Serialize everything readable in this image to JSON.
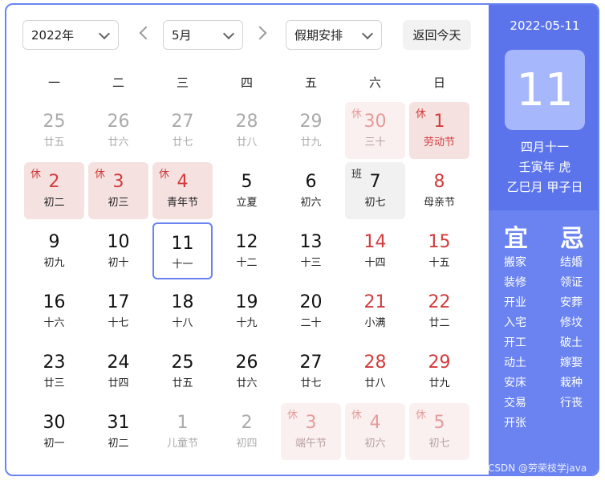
{
  "toolbar": {
    "year": "2022年",
    "month": "5月",
    "holiday": "假期安排",
    "today_button": "返回今天"
  },
  "weekdays": [
    "一",
    "二",
    "三",
    "四",
    "五",
    "六",
    "日"
  ],
  "days": [
    {
      "n": "25",
      "s": "廿五",
      "st": "other"
    },
    {
      "n": "26",
      "s": "廿六",
      "st": "other"
    },
    {
      "n": "27",
      "s": "廿七",
      "st": "other"
    },
    {
      "n": "28",
      "s": "廿八",
      "st": "other"
    },
    {
      "n": "29",
      "s": "廿九",
      "st": "other"
    },
    {
      "n": "30",
      "s": "三十",
      "st": "other rest",
      "t": "休"
    },
    {
      "n": "1",
      "s": "劳动节",
      "st": "rest",
      "t": "休"
    },
    {
      "n": "2",
      "s": "初二",
      "st": "rest plainsub",
      "t": "休"
    },
    {
      "n": "3",
      "s": "初三",
      "st": "rest plainsub",
      "t": "休"
    },
    {
      "n": "4",
      "s": "青年节",
      "st": "rest plainsub",
      "t": "休"
    },
    {
      "n": "5",
      "s": "立夏",
      "st": ""
    },
    {
      "n": "6",
      "s": "初六",
      "st": ""
    },
    {
      "n": "7",
      "s": "初七",
      "st": "work",
      "t": "班"
    },
    {
      "n": "8",
      "s": "母亲节",
      "st": "weekend"
    },
    {
      "n": "9",
      "s": "初九",
      "st": ""
    },
    {
      "n": "10",
      "s": "初十",
      "st": ""
    },
    {
      "n": "11",
      "s": "十一",
      "st": "selected"
    },
    {
      "n": "12",
      "s": "十二",
      "st": ""
    },
    {
      "n": "13",
      "s": "十三",
      "st": ""
    },
    {
      "n": "14",
      "s": "十四",
      "st": "weekend"
    },
    {
      "n": "15",
      "s": "十五",
      "st": "weekend"
    },
    {
      "n": "16",
      "s": "十六",
      "st": ""
    },
    {
      "n": "17",
      "s": "十七",
      "st": ""
    },
    {
      "n": "18",
      "s": "十八",
      "st": ""
    },
    {
      "n": "19",
      "s": "十九",
      "st": ""
    },
    {
      "n": "20",
      "s": "二十",
      "st": ""
    },
    {
      "n": "21",
      "s": "小满",
      "st": "weekend"
    },
    {
      "n": "22",
      "s": "廿二",
      "st": "weekend"
    },
    {
      "n": "23",
      "s": "廿三",
      "st": ""
    },
    {
      "n": "24",
      "s": "廿四",
      "st": ""
    },
    {
      "n": "25",
      "s": "廿五",
      "st": ""
    },
    {
      "n": "26",
      "s": "廿六",
      "st": ""
    },
    {
      "n": "27",
      "s": "廿七",
      "st": ""
    },
    {
      "n": "28",
      "s": "廿八",
      "st": "weekend"
    },
    {
      "n": "29",
      "s": "廿九",
      "st": "weekend"
    },
    {
      "n": "30",
      "s": "初一",
      "st": ""
    },
    {
      "n": "31",
      "s": "初二",
      "st": ""
    },
    {
      "n": "1",
      "s": "儿童节",
      "st": "other"
    },
    {
      "n": "2",
      "s": "初四",
      "st": "other"
    },
    {
      "n": "3",
      "s": "端午节",
      "st": "other rest",
      "t": "休"
    },
    {
      "n": "4",
      "s": "初六",
      "st": "other rest",
      "t": "休"
    },
    {
      "n": "5",
      "s": "初七",
      "st": "other rest",
      "t": "休"
    }
  ],
  "side": {
    "date": "2022-05-11",
    "day": "11",
    "lunar_lines": [
      "四月十一",
      "壬寅年 虎",
      "乙巳月 甲子日"
    ],
    "yi_title": "宜",
    "ji_title": "忌",
    "yi": [
      "搬家",
      "装修",
      "开业",
      "入宅",
      "开工",
      "动土",
      "安床",
      "交易",
      "开张"
    ],
    "ji": [
      "结婚",
      "领证",
      "安葬",
      "修坟",
      "破土",
      "嫁娶",
      "栽种",
      "行丧"
    ]
  },
  "watermark": "CSDN @劳荣枝学java",
  "colors": {
    "accent": "#6a83f0",
    "rest_bg": "#f6e1e1",
    "holiday_red": "#d23c3c"
  }
}
